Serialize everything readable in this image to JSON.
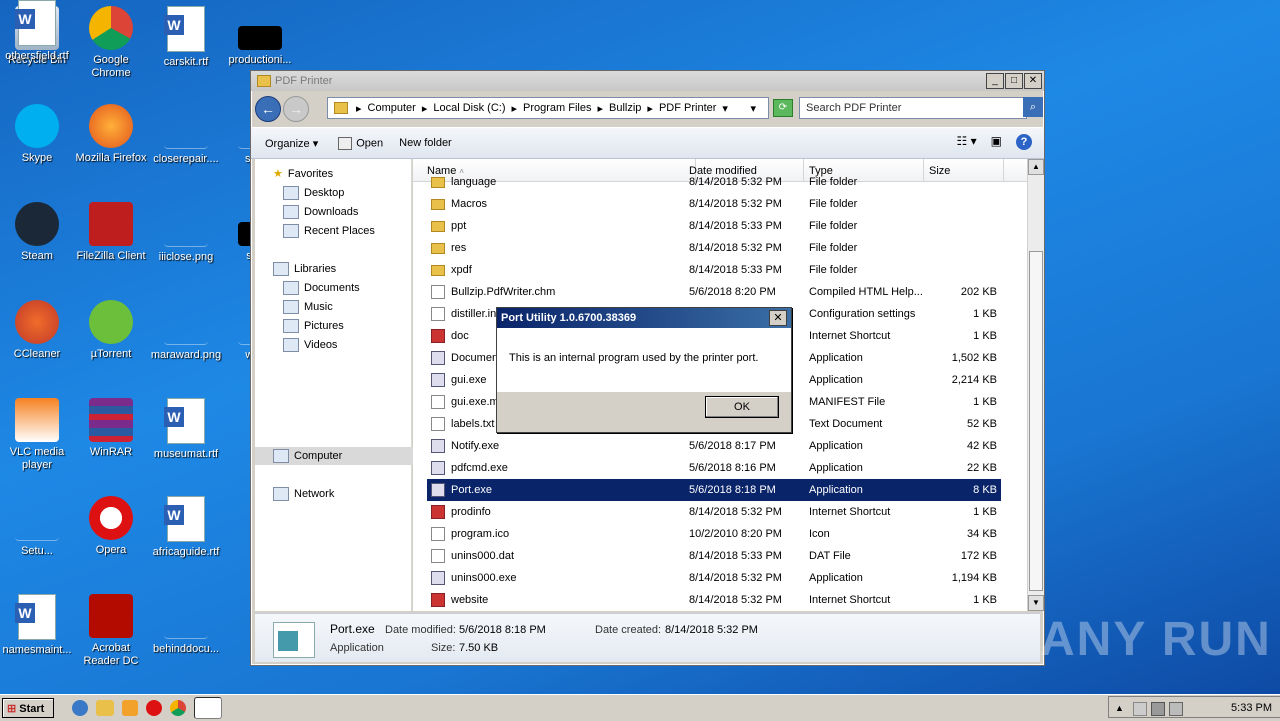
{
  "desktop": {
    "icons": [
      {
        "label": "Recycle Bin",
        "icon": "recycle-bin-icon"
      },
      {
        "label": "Google Chrome",
        "icon": "chrome-icon"
      },
      {
        "label": "carskit.rtf",
        "icon": "word-doc-icon"
      },
      {
        "label": "productioni...",
        "icon": "black-image-icon"
      },
      {
        "label": "Skype",
        "icon": "skype-icon"
      },
      {
        "label": "Mozilla Firefox",
        "icon": "firefox-icon"
      },
      {
        "label": "closerepair....",
        "icon": "file-icon"
      },
      {
        "label": "stan...",
        "icon": "file-icon"
      },
      {
        "label": "Steam",
        "icon": "steam-icon"
      },
      {
        "label": "FileZilla Client",
        "icon": "filezilla-icon"
      },
      {
        "label": "iiiclose.png",
        "icon": "image-icon"
      },
      {
        "label": "stre...",
        "icon": "black-image-icon"
      },
      {
        "label": "CCleaner",
        "icon": "ccleaner-icon"
      },
      {
        "label": "µTorrent",
        "icon": "utorrent-icon"
      },
      {
        "label": "maraward.png",
        "icon": "image-icon"
      },
      {
        "label": "who...",
        "icon": "file-icon"
      },
      {
        "label": "VLC media player",
        "icon": "vlc-icon"
      },
      {
        "label": "WinRAR",
        "icon": "winrar-icon"
      },
      {
        "label": "museumat.rtf",
        "icon": "word-doc-icon"
      },
      {
        "label": "Setu...",
        "icon": "file-icon"
      },
      {
        "label": "Opera",
        "icon": "opera-icon"
      },
      {
        "label": "africaguide.rtf",
        "icon": "word-doc-icon"
      },
      {
        "label": "namesmaint...",
        "icon": "word-doc-icon"
      },
      {
        "label": "Acrobat Reader DC",
        "icon": "acrobat-icon"
      },
      {
        "label": "behinddocu...",
        "icon": "file-icon"
      },
      {
        "label": "othersfield.rtf",
        "icon": "word-doc-icon"
      }
    ]
  },
  "window": {
    "title": "PDF Printer",
    "breadcrumb": [
      "Computer",
      "Local Disk (C:)",
      "Program Files",
      "Bullzip",
      "PDF Printer"
    ],
    "search_placeholder": "Search PDF Printer",
    "toolbar": {
      "organize": "Organize",
      "open": "Open",
      "new_folder": "New folder"
    },
    "nav": {
      "favorites": "Favorites",
      "favorites_items": [
        "Desktop",
        "Downloads",
        "Recent Places"
      ],
      "libraries": "Libraries",
      "libraries_items": [
        "Documents",
        "Music",
        "Pictures",
        "Videos"
      ],
      "computer": "Computer",
      "network": "Network"
    },
    "columns": {
      "name": "Name",
      "date": "Date modified",
      "type": "Type",
      "size": "Size"
    },
    "files": [
      {
        "name": "language",
        "date": "8/14/2018 5:32 PM",
        "type": "File folder",
        "size": "",
        "kind": "folder"
      },
      {
        "name": "Macros",
        "date": "8/14/2018 5:32 PM",
        "type": "File folder",
        "size": "",
        "kind": "folder"
      },
      {
        "name": "ppt",
        "date": "8/14/2018 5:33 PM",
        "type": "File folder",
        "size": "",
        "kind": "folder"
      },
      {
        "name": "res",
        "date": "8/14/2018 5:32 PM",
        "type": "File folder",
        "size": "",
        "kind": "folder"
      },
      {
        "name": "xpdf",
        "date": "8/14/2018 5:33 PM",
        "type": "File folder",
        "size": "",
        "kind": "folder"
      },
      {
        "name": "Bullzip.PdfWriter.chm",
        "date": "5/6/2018 8:20 PM",
        "type": "Compiled HTML Help...",
        "size": "202 KB",
        "kind": "file"
      },
      {
        "name": "distiller.ini",
        "date": "",
        "type": "Configuration settings",
        "size": "1 KB",
        "kind": "file"
      },
      {
        "name": "doc",
        "date": "",
        "type": "Internet Shortcut",
        "size": "1 KB",
        "kind": "link"
      },
      {
        "name": "Document...",
        "date": "",
        "type": "Application",
        "size": "1,502 KB",
        "kind": "app"
      },
      {
        "name": "gui.exe",
        "date": "",
        "type": "Application",
        "size": "2,214 KB",
        "kind": "app"
      },
      {
        "name": "gui.exe.m...",
        "date": "",
        "type": "MANIFEST File",
        "size": "1 KB",
        "kind": "file"
      },
      {
        "name": "labels.txt",
        "date": "",
        "type": "Text Document",
        "size": "52 KB",
        "kind": "file"
      },
      {
        "name": "Notify.exe",
        "date": "5/6/2018 8:17 PM",
        "type": "Application",
        "size": "42 KB",
        "kind": "app"
      },
      {
        "name": "pdfcmd.exe",
        "date": "5/6/2018 8:16 PM",
        "type": "Application",
        "size": "22 KB",
        "kind": "app"
      },
      {
        "name": "Port.exe",
        "date": "5/6/2018 8:18 PM",
        "type": "Application",
        "size": "8 KB",
        "kind": "app",
        "selected": true
      },
      {
        "name": "prodinfo",
        "date": "8/14/2018 5:32 PM",
        "type": "Internet Shortcut",
        "size": "1 KB",
        "kind": "link"
      },
      {
        "name": "program.ico",
        "date": "10/2/2010 8:20 PM",
        "type": "Icon",
        "size": "34 KB",
        "kind": "file"
      },
      {
        "name": "unins000.dat",
        "date": "8/14/2018 5:33 PM",
        "type": "DAT File",
        "size": "172 KB",
        "kind": "file"
      },
      {
        "name": "unins000.exe",
        "date": "8/14/2018 5:32 PM",
        "type": "Application",
        "size": "1,194 KB",
        "kind": "app"
      },
      {
        "name": "website",
        "date": "8/14/2018 5:32 PM",
        "type": "Internet Shortcut",
        "size": "1 KB",
        "kind": "link"
      }
    ],
    "details": {
      "name": "Port.exe",
      "date_modified_label": "Date modified:",
      "date_modified": "5/6/2018 8:18 PM",
      "date_created_label": "Date created:",
      "date_created": "8/14/2018 5:32 PM",
      "type": "Application",
      "size_label": "Size:",
      "size": "7.50 KB"
    }
  },
  "dialog": {
    "title": "Port Utility 1.0.6700.38369",
    "message": "This is an internal program used by the printer port.",
    "ok": "OK"
  },
  "watermark": "ANY RUN",
  "taskbar": {
    "start": "Start",
    "clock": "5:33 PM"
  }
}
